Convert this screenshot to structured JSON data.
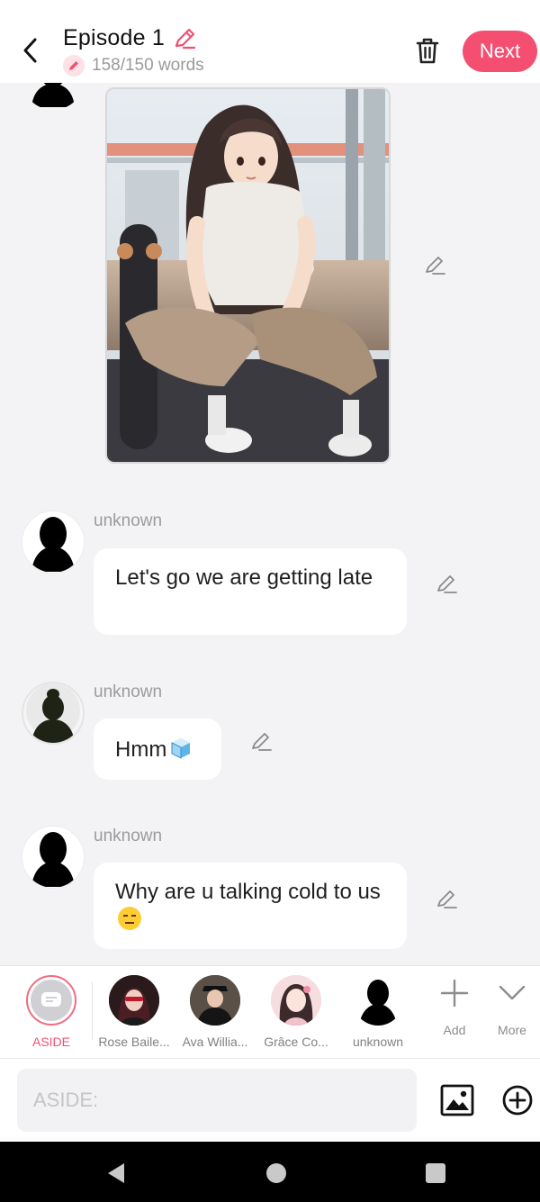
{
  "header": {
    "title": "Episode 1",
    "word_count": "158/150 words",
    "next_label": "Next"
  },
  "messages": [
    {
      "speaker": "unknown",
      "text": "Let's go we are getting late"
    },
    {
      "speaker": "unknown",
      "text": "Hmm"
    },
    {
      "speaker": "unknown",
      "text": "Why are u talking cold to us"
    }
  ],
  "characters": [
    {
      "label": "ASIDE",
      "selected": true
    },
    {
      "label": "Rose Baile..."
    },
    {
      "label": "Ava Willia..."
    },
    {
      "label": "Grâce Co..."
    },
    {
      "label": "unknown"
    }
  ],
  "tools": {
    "add_label": "Add",
    "more_label": "More"
  },
  "composer": {
    "placeholder": "ASIDE:"
  },
  "colors": {
    "accent": "#f44f70",
    "background": "#f3f3f5",
    "bubble": "#ffffff"
  },
  "icons": [
    "back-arrow-icon",
    "pencil-icon",
    "trash-icon",
    "image-icon",
    "plus-circle-icon",
    "plus-icon",
    "chevron-down-icon",
    "silhouette-icon",
    "ice-cube-icon",
    "expressionless-face-icon"
  ]
}
